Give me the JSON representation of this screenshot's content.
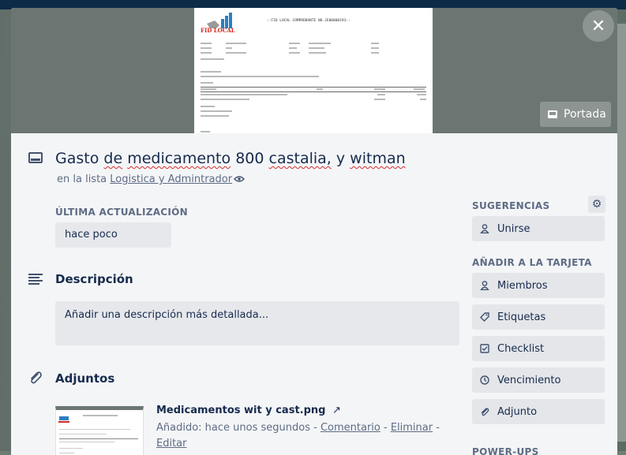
{
  "card": {
    "title_parts": [
      "Gasto",
      "de",
      "medicamento",
      "800",
      "castalia,",
      "y",
      "witman"
    ],
    "title": "Gasto de medicamento 800 castalia, y witman",
    "list_prefix": "en la lista",
    "list_name": "Logistica y Admintrador"
  },
  "cover": {
    "portada_label": "Portada",
    "doc": {
      "logo_text": "FID LOCAL",
      "header": "::FID LOCAL COMPROBANTE NO.JE00000193::"
    }
  },
  "updated": {
    "label": "ÚLTIMA ACTUALIZACIÓN",
    "value": "hace poco"
  },
  "description": {
    "heading": "Descripción",
    "placeholder": "Añadir una descripción más detallada..."
  },
  "attachments": {
    "heading": "Adjuntos",
    "items": [
      {
        "name": "Medicamentos wit y cast.png",
        "added_prefix": "Añadido: hace unos segundos",
        "actions": [
          "Comentario",
          "Eliminar",
          "Editar"
        ]
      }
    ]
  },
  "sidebar": {
    "suggestions_label": "SUGERENCIAS",
    "join_label": "Unirse",
    "add_label": "AÑADIR A LA TARJETA",
    "items": [
      {
        "label": "Miembros",
        "icon": "person-icon"
      },
      {
        "label": "Etiquetas",
        "icon": "tag-icon"
      },
      {
        "label": "Checklist",
        "icon": "checkbox-icon"
      },
      {
        "label": "Vencimiento",
        "icon": "clock-icon"
      },
      {
        "label": "Adjunto",
        "icon": "paperclip-icon"
      }
    ],
    "powerups_label": "POWER-UPS"
  },
  "colors": {
    "accent": "#172b4d",
    "muted": "#5e6c84",
    "button_bg": "#e4e6ea",
    "spell_underline": "#d82c2c"
  }
}
